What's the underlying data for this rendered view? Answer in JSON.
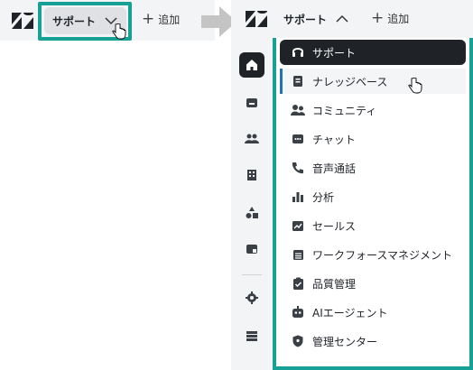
{
  "left": {
    "app_button_label": "サポート",
    "add_label": "追加"
  },
  "right": {
    "app_button_label": "サポート",
    "add_label": "追加",
    "rail": [
      "home-icon",
      "inbox-icon",
      "users-icon",
      "building-icon",
      "shapes-icon",
      "window-icon",
      "gear-icon",
      "database-icon"
    ],
    "menu": [
      {
        "label": "サポート",
        "icon": "headset-icon",
        "state": "selected"
      },
      {
        "label": "ナレッジベース",
        "icon": "book-icon",
        "state": "hover"
      },
      {
        "label": "コミュニティ",
        "icon": "people-icon"
      },
      {
        "label": "チャット",
        "icon": "chat-icon"
      },
      {
        "label": "音声通話",
        "icon": "phone-icon"
      },
      {
        "label": "分析",
        "icon": "bar-chart-icon"
      },
      {
        "label": "セールス",
        "icon": "trend-icon"
      },
      {
        "label": "ワークフォースマネジメント",
        "icon": "calendar-icon"
      },
      {
        "label": "品質管理",
        "icon": "clipboard-check-icon"
      },
      {
        "label": "AIエージェント",
        "icon": "robot-icon"
      },
      {
        "label": "管理センター",
        "icon": "shield-icon"
      }
    ]
  },
  "colors": {
    "accent_outline": "#17a096",
    "selected_bg": "#1f2328",
    "hover_marker": "#1f73b7"
  }
}
